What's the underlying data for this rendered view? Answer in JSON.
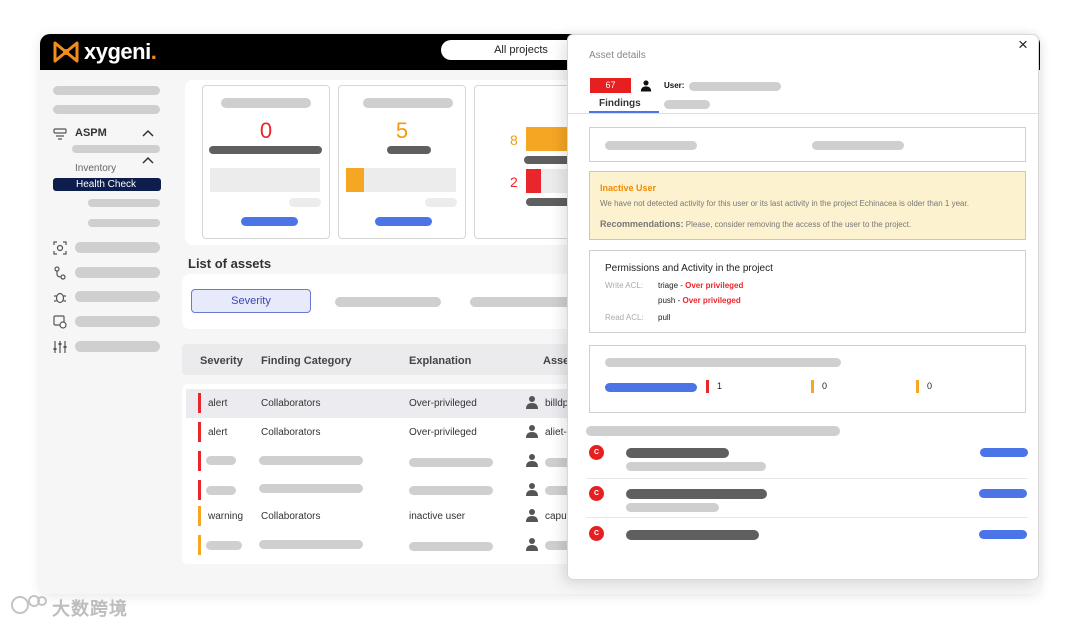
{
  "brand": {
    "name": "xygeni",
    "dot": ".",
    "accent": "#f28c1b"
  },
  "header": {
    "project_selector": "All projects"
  },
  "sidebar": {
    "section": "ASPM",
    "sub_items": [
      "Inventory",
      "Health Check"
    ],
    "active_item": "Health Check",
    "icons": [
      "aspm-icon",
      "scan-icon",
      "pipeline-icon",
      "bug-icon",
      "device-icon",
      "sliders-icon"
    ]
  },
  "summary_cards": [
    {
      "value": "0",
      "color": "#e8262b"
    },
    {
      "value": "5",
      "color": "#f39c12"
    }
  ],
  "bar_card": {
    "values": [
      {
        "value": "8",
        "color": "#f39c12",
        "fill": 1.0
      },
      {
        "value": "2",
        "color": "#e8262b",
        "fill": 0.35
      }
    ]
  },
  "assets": {
    "title": "List of assets",
    "filter_button": "Severity",
    "columns": [
      "Severity",
      "Finding Category",
      "Explanation",
      "Asset"
    ],
    "rows": [
      {
        "severity": "alert",
        "category": "Collaborators",
        "explanation": "Over-privileged",
        "asset": "billdp",
        "color": "#e8262b",
        "highlight": true
      },
      {
        "severity": "alert",
        "category": "Collaborators",
        "explanation": "Over-privileged",
        "asset": "aliet-",
        "color": "#e8262b",
        "highlight": false
      },
      {
        "severity": "",
        "category": "",
        "explanation": "",
        "asset": "",
        "color": "#e8262b",
        "highlight": false
      },
      {
        "severity": "",
        "category": "",
        "explanation": "",
        "asset": "",
        "color": "#e8262b",
        "highlight": false
      },
      {
        "severity": "warning",
        "category": "Collaborators",
        "explanation": "inactive user",
        "asset": "caput",
        "color": "#f5a623",
        "highlight": false
      },
      {
        "severity": "",
        "category": "",
        "explanation": "",
        "asset": "",
        "color": "#f5a623",
        "highlight": false
      }
    ]
  },
  "panel": {
    "title": "Asset details",
    "close": "×",
    "badge": "67",
    "user_label": "User:",
    "tab_findings": "Findings",
    "alert": {
      "title": "Inactive User",
      "text": "We have not detected activity for this user or its last activity in the project Echinacea is older than 1 year.",
      "rec_label": "Recommendations:",
      "rec_text": "Please, consider removing the access of the user to the project."
    },
    "permissions": {
      "title": "Permissions and Activity in the project",
      "write_label": "Write ACL:",
      "write_items": [
        {
          "name": "triage",
          "sep": " - ",
          "status": "Over privileged"
        },
        {
          "name": "push",
          "sep": " - ",
          "status": "Over privileged"
        }
      ],
      "read_label": "Read ACL:",
      "read_items": [
        "pull"
      ]
    },
    "counts": [
      {
        "value": "1",
        "color": "#e8262b"
      },
      {
        "value": "0",
        "color": "#f5a623"
      },
      {
        "value": "0",
        "color": "#f5a623"
      }
    ],
    "findings": [
      {
        "chip": "C"
      },
      {
        "chip": "C"
      },
      {
        "chip": "C"
      }
    ]
  },
  "watermark": "大数跨境"
}
